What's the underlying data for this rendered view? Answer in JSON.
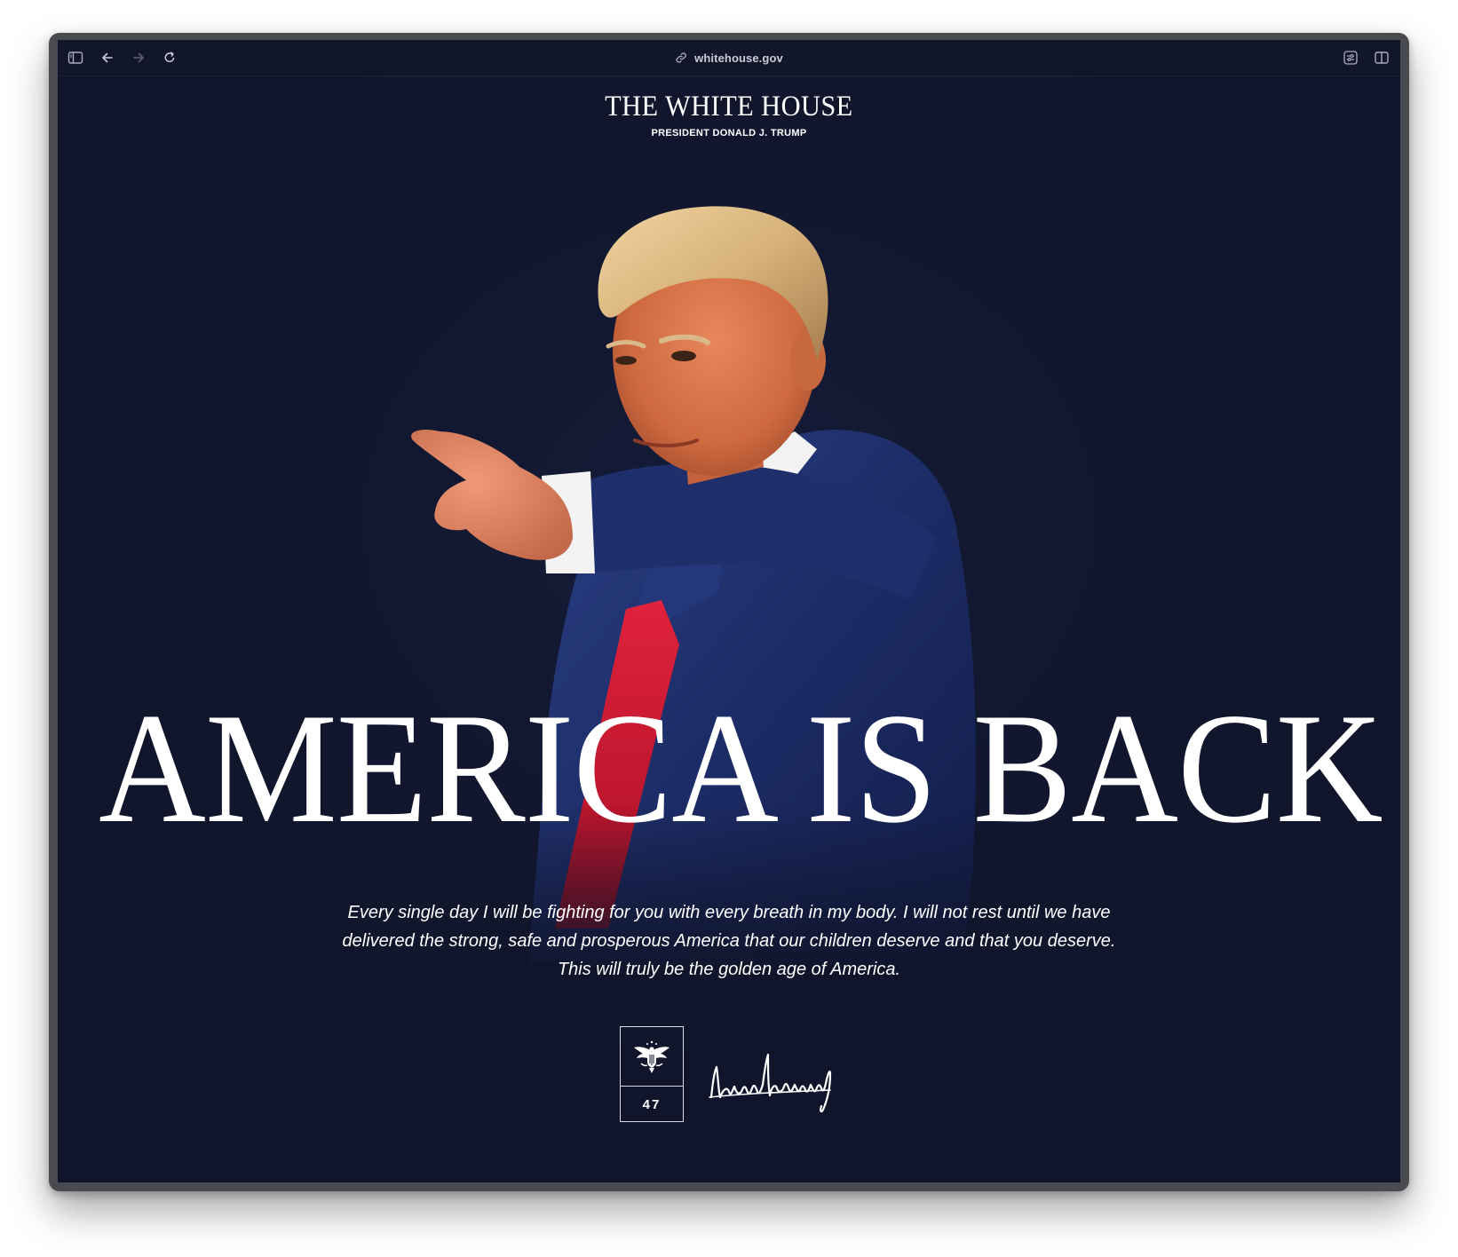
{
  "browser": {
    "url": "whitehouse.gov",
    "icons": {
      "sidebar": "sidebar-icon",
      "back": "back-arrow-icon",
      "forward": "forward-arrow-icon",
      "reload": "reload-icon",
      "link": "link-icon",
      "reader": "page-settings-icon",
      "split": "split-view-icon"
    }
  },
  "site": {
    "title": "THE WHITE HOUSE",
    "subtitle": "PRESIDENT DONALD J. TRUMP"
  },
  "hero": {
    "headline": "AMERICA IS BACK",
    "quote_lines": [
      "Every single day I will be fighting for you with every breath in my body. I will not rest until we have",
      "delivered the strong, safe and prosperous America that our children deserve and that you deserve.",
      "This will truly be the golden age of America."
    ]
  },
  "emblem": {
    "number": "47",
    "icon": "presidential-eagle-icon"
  },
  "signature": {
    "icon": "signature-image"
  },
  "colors": {
    "page_background": "#10152b",
    "text": "#ffffff",
    "tie_red": "#c8102e",
    "suit_navy": "#1d2f63"
  }
}
